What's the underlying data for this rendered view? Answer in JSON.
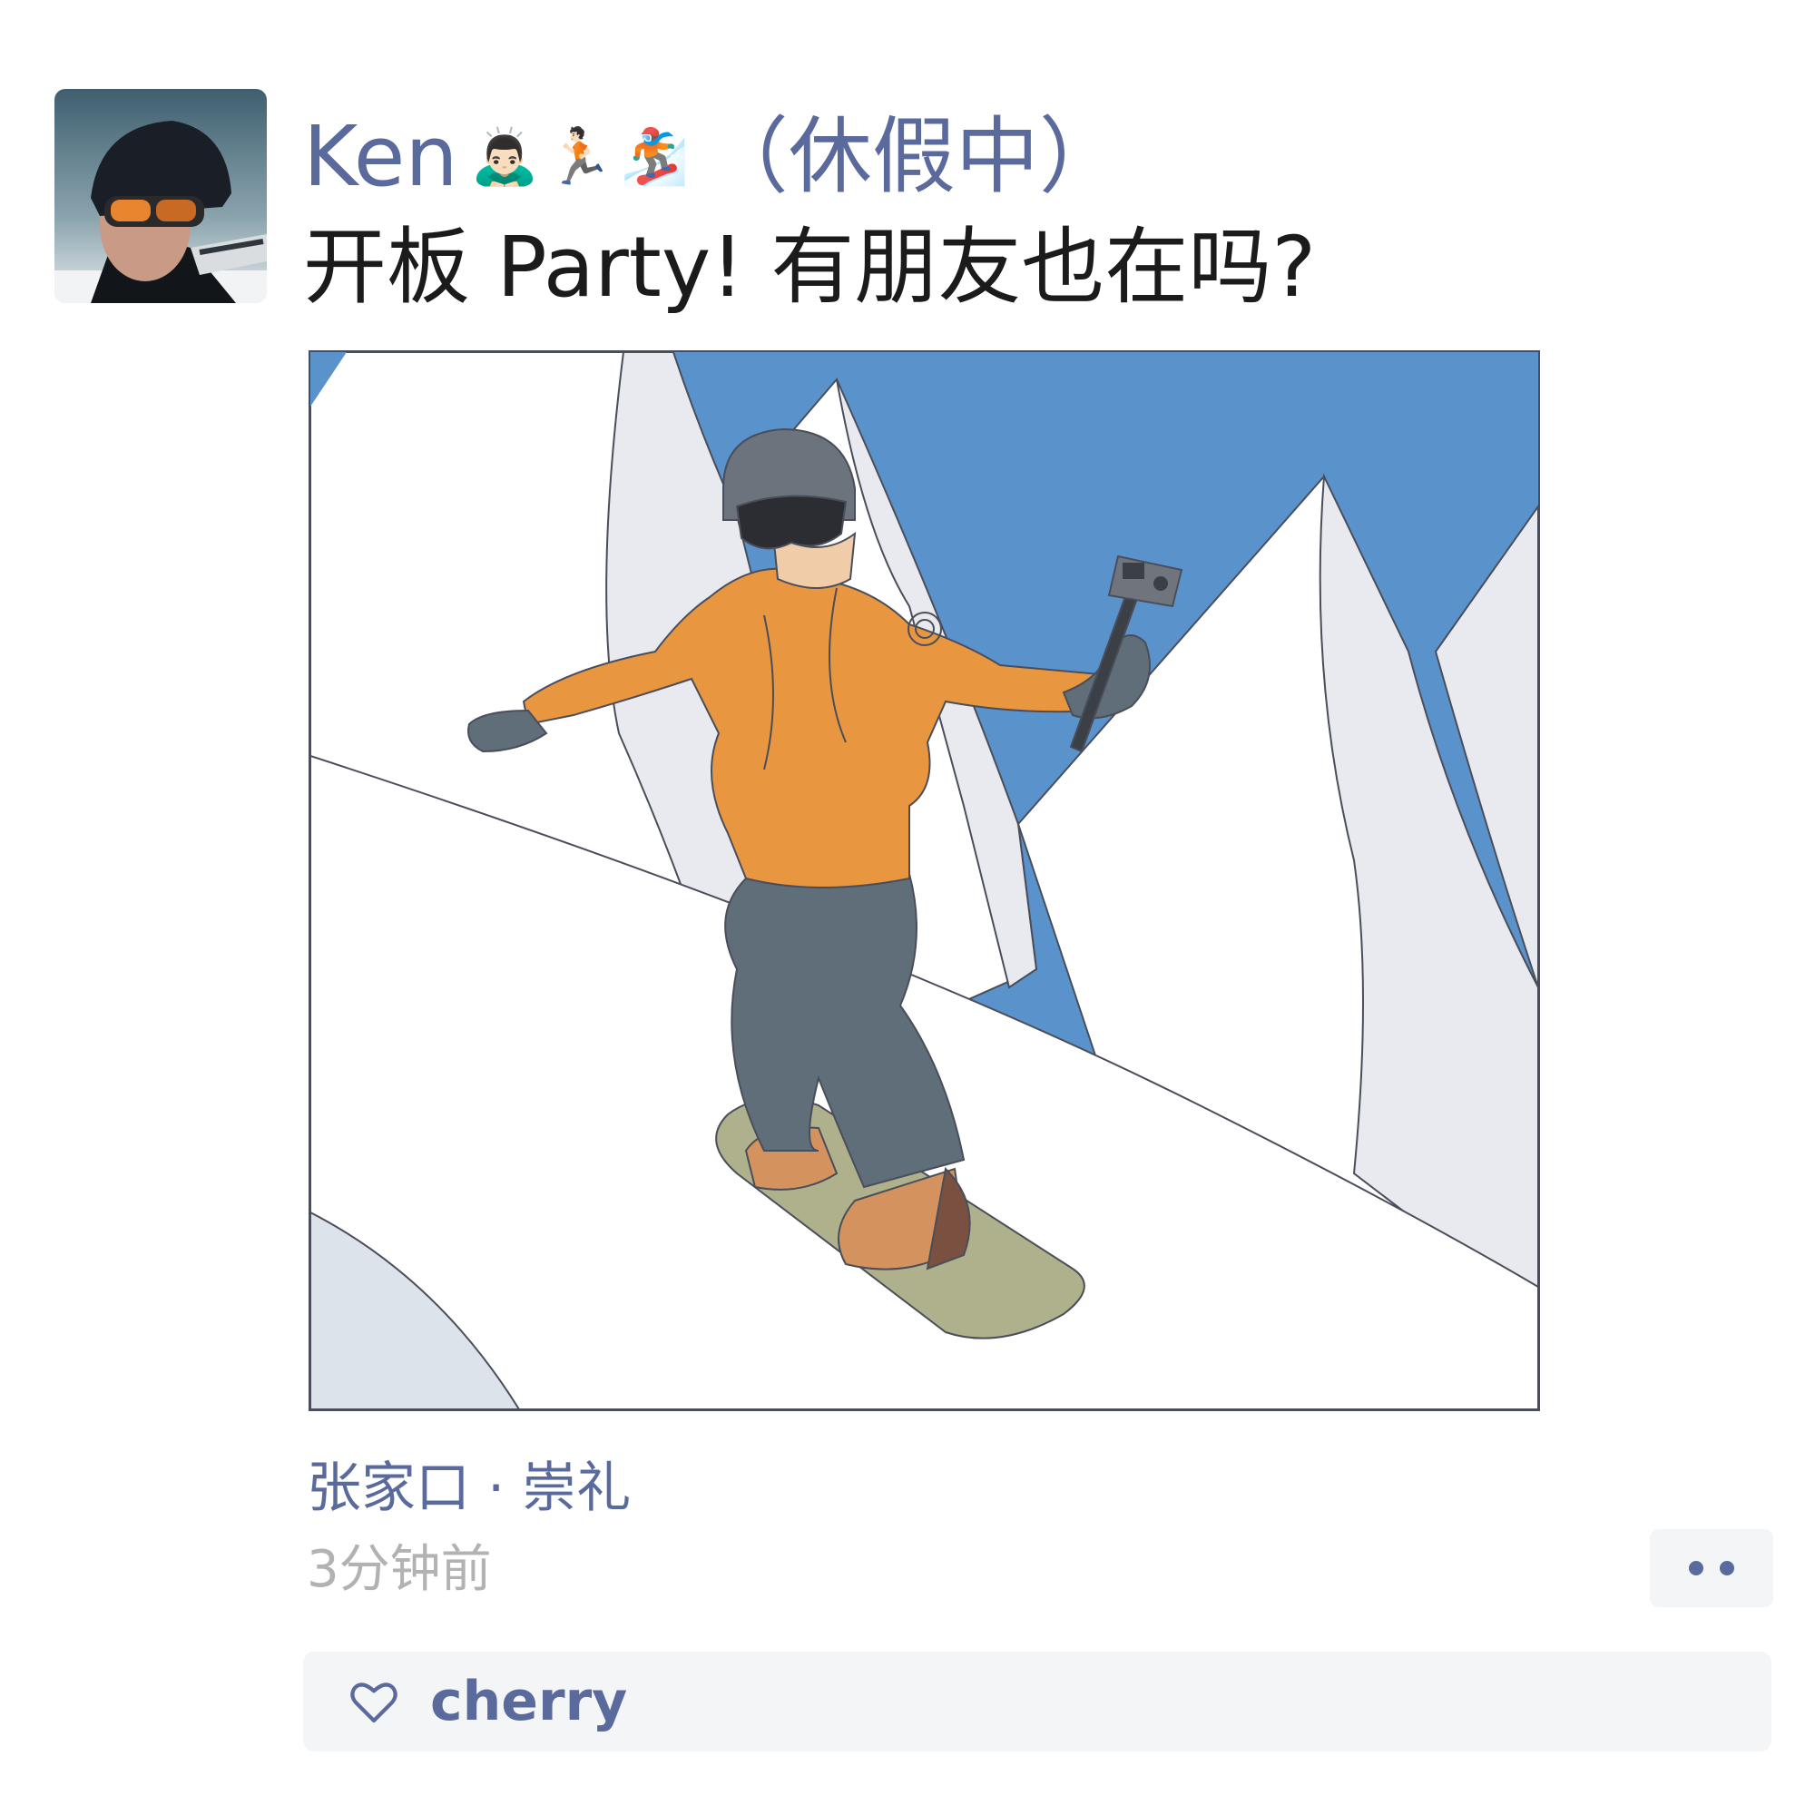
{
  "post": {
    "author": {
      "name": "Ken",
      "emojis": [
        "🙇🏻‍♂️",
        "🏃🏻",
        "🏂"
      ],
      "status": "（休假中）"
    },
    "text": "开板 Party! 有朋友也在吗?",
    "location": "张家口 · 崇礼",
    "time": "3分钟前",
    "likes": {
      "icon": "heart-outline-icon",
      "users": [
        "cherry"
      ]
    },
    "more_icon": "more-dots-icon"
  },
  "colors": {
    "name": "#5a6a9c",
    "text": "#1b1b1b",
    "time": "#b2b2b2",
    "panel": "#f4f5f7",
    "sky": "#5a92cc",
    "jacket": "#e8963f",
    "pants": "#5f6e78",
    "board": "#aeb18b"
  }
}
